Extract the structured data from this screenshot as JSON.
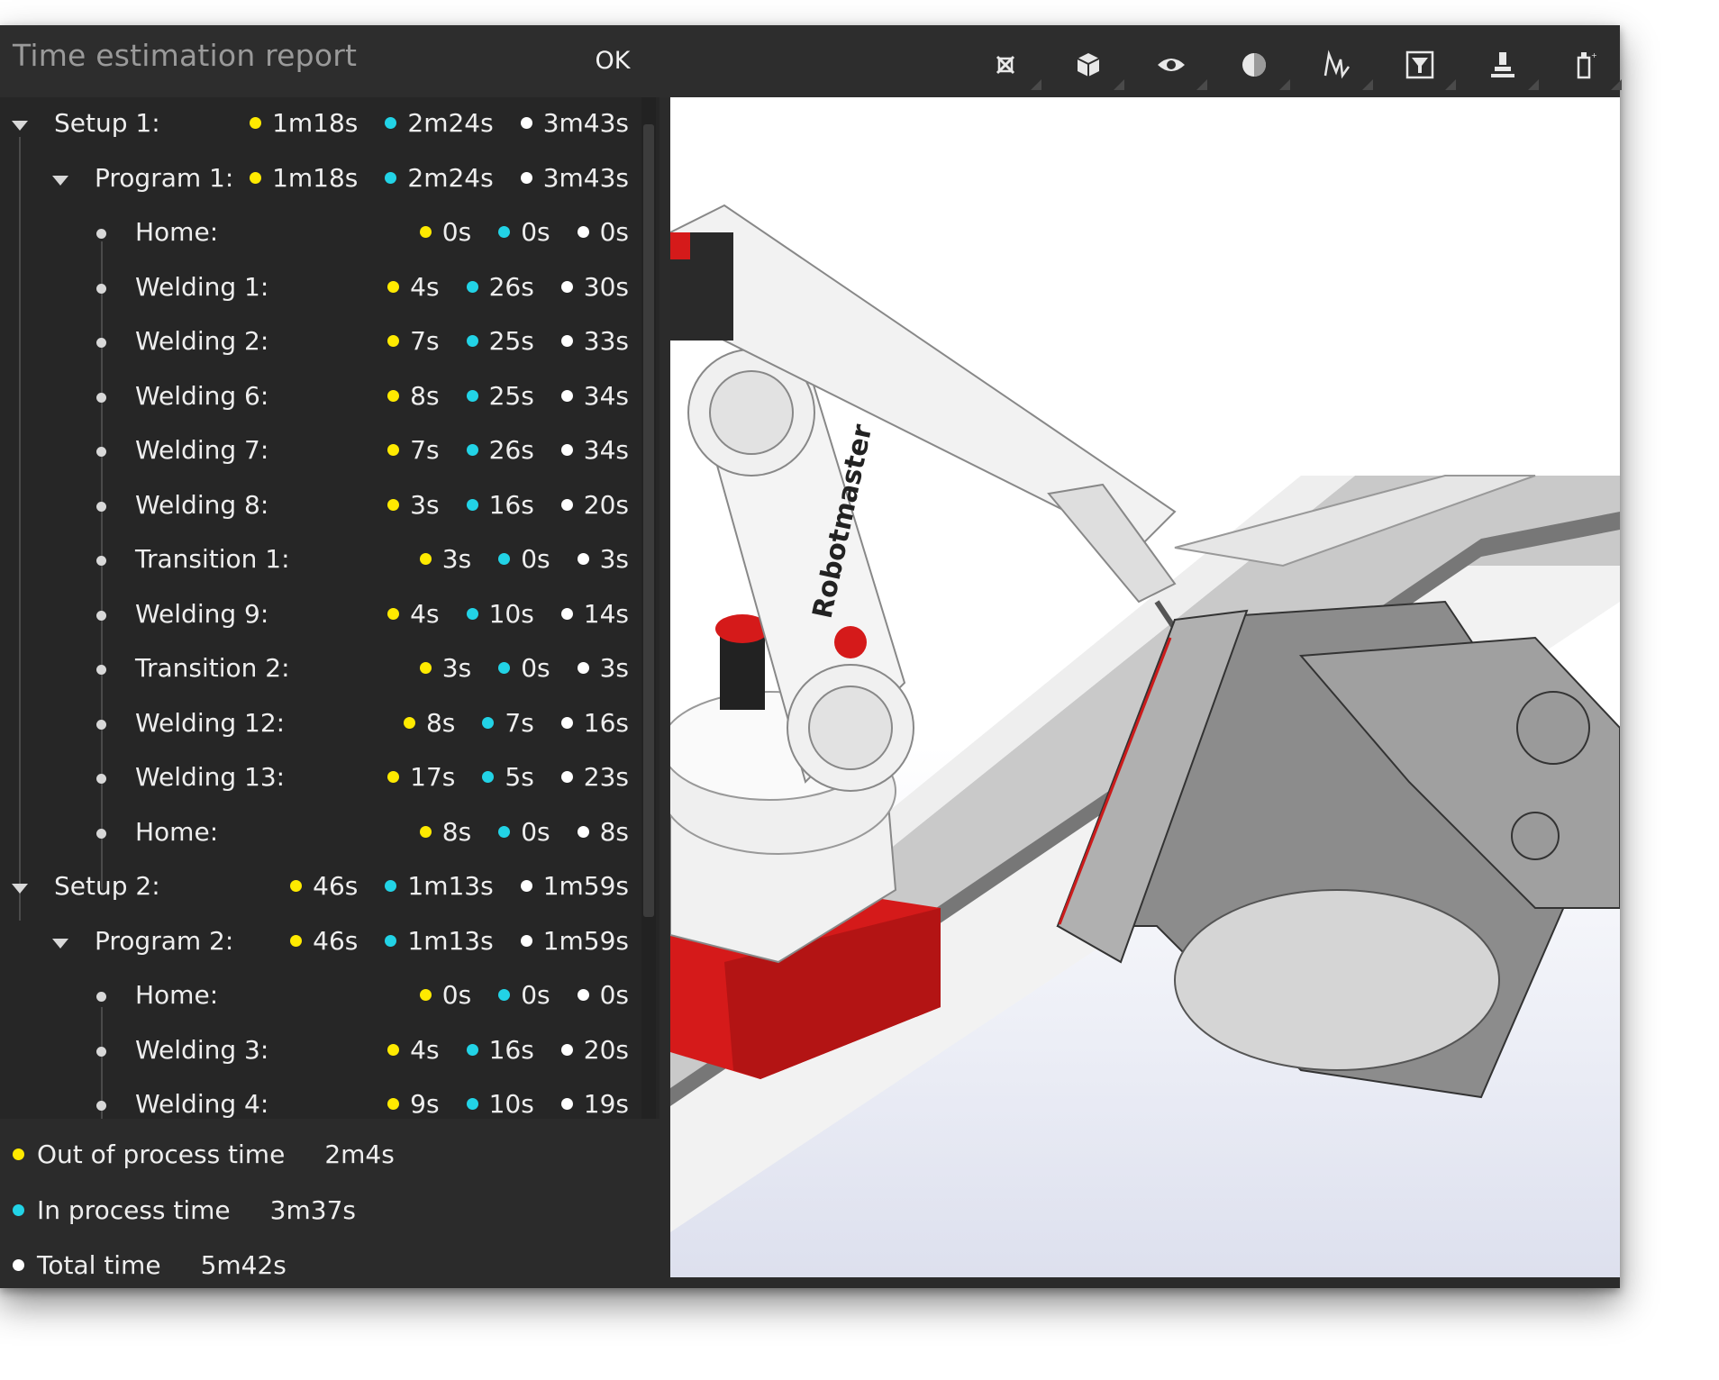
{
  "title": "Time estimation report",
  "ok_label": "OK",
  "toolbar_icons": [
    "fit-all-icon",
    "cube-view-icon",
    "visibility-eye-icon",
    "shading-sphere-icon",
    "toolpath-curve-icon",
    "filter-icon",
    "robot-tool-icon",
    "extras-icon"
  ],
  "legend_colors": {
    "out_of_process": "#ffea00",
    "in_process": "#22d3e6",
    "total": "#ffffff"
  },
  "tree": [
    {
      "label": "Setup 1:",
      "out": "1m18s",
      "in": "2m24s",
      "total": "3m43s"
    },
    {
      "label": "Program 1:",
      "out": "1m18s",
      "in": "2m24s",
      "total": "3m43s"
    },
    {
      "label": "Home:",
      "out": "0s",
      "in": "0s",
      "total": "0s"
    },
    {
      "label": "Welding 1:",
      "out": "4s",
      "in": "26s",
      "total": "30s"
    },
    {
      "label": "Welding 2:",
      "out": "7s",
      "in": "25s",
      "total": "33s"
    },
    {
      "label": "Welding 6:",
      "out": "8s",
      "in": "25s",
      "total": "34s"
    },
    {
      "label": "Welding 7:",
      "out": "7s",
      "in": "26s",
      "total": "34s"
    },
    {
      "label": "Welding 8:",
      "out": "3s",
      "in": "16s",
      "total": "20s"
    },
    {
      "label": "Transition 1:",
      "out": "3s",
      "in": "0s",
      "total": "3s"
    },
    {
      "label": "Welding 9:",
      "out": "4s",
      "in": "10s",
      "total": "14s"
    },
    {
      "label": "Transition 2:",
      "out": "3s",
      "in": "0s",
      "total": "3s"
    },
    {
      "label": "Welding 12:",
      "out": "8s",
      "in": "7s",
      "total": "16s"
    },
    {
      "label": "Welding 13:",
      "out": "17s",
      "in": "5s",
      "total": "23s"
    },
    {
      "label": "Home:",
      "out": "8s",
      "in": "0s",
      "total": "8s"
    },
    {
      "label": "Setup 2:",
      "out": "46s",
      "in": "1m13s",
      "total": "1m59s"
    },
    {
      "label": "Program 2:",
      "out": "46s",
      "in": "1m13s",
      "total": "1m59s"
    },
    {
      "label": "Home:",
      "out": "0s",
      "in": "0s",
      "total": "0s"
    },
    {
      "label": "Welding 3:",
      "out": "4s",
      "in": "16s",
      "total": "20s"
    },
    {
      "label": "Welding 4:",
      "out": "9s",
      "in": "10s",
      "total": "19s"
    }
  ],
  "summary": [
    {
      "label": "Out of process time",
      "value": "2m4s"
    },
    {
      "label": "In process time",
      "value": "3m37s"
    },
    {
      "label": "Total time",
      "value": "5m42s"
    }
  ],
  "viewport": {
    "robot_brand": "Robotmaster"
  }
}
